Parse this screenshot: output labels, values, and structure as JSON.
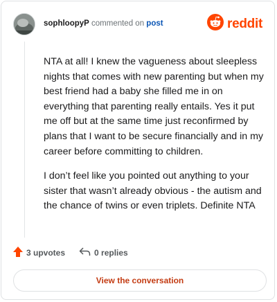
{
  "comment": {
    "author": "sophloopyP",
    "action_text": "commented on",
    "target_text": "post",
    "paragraphs": [
      "NTA at all! I knew the vagueness about sleepless nights that comes with new parenting but when my best friend had a baby she filled me in on everything that parenting really entails. Yes it put me off but at the same time just reconfirmed by plans that I want to be secure financially and in my career before committing to children.",
      "I don’t feel like you pointed out anything to your sister that wasn’t already obvious - the autism and the chance of twins or even triplets. Definite NTA"
    ]
  },
  "brand": {
    "name": "reddit",
    "color": "#ff4500"
  },
  "actions": {
    "upvotes_label": "3 upvotes",
    "replies_label": "0 replies"
  },
  "footer": {
    "button_label": "View the conversation"
  }
}
